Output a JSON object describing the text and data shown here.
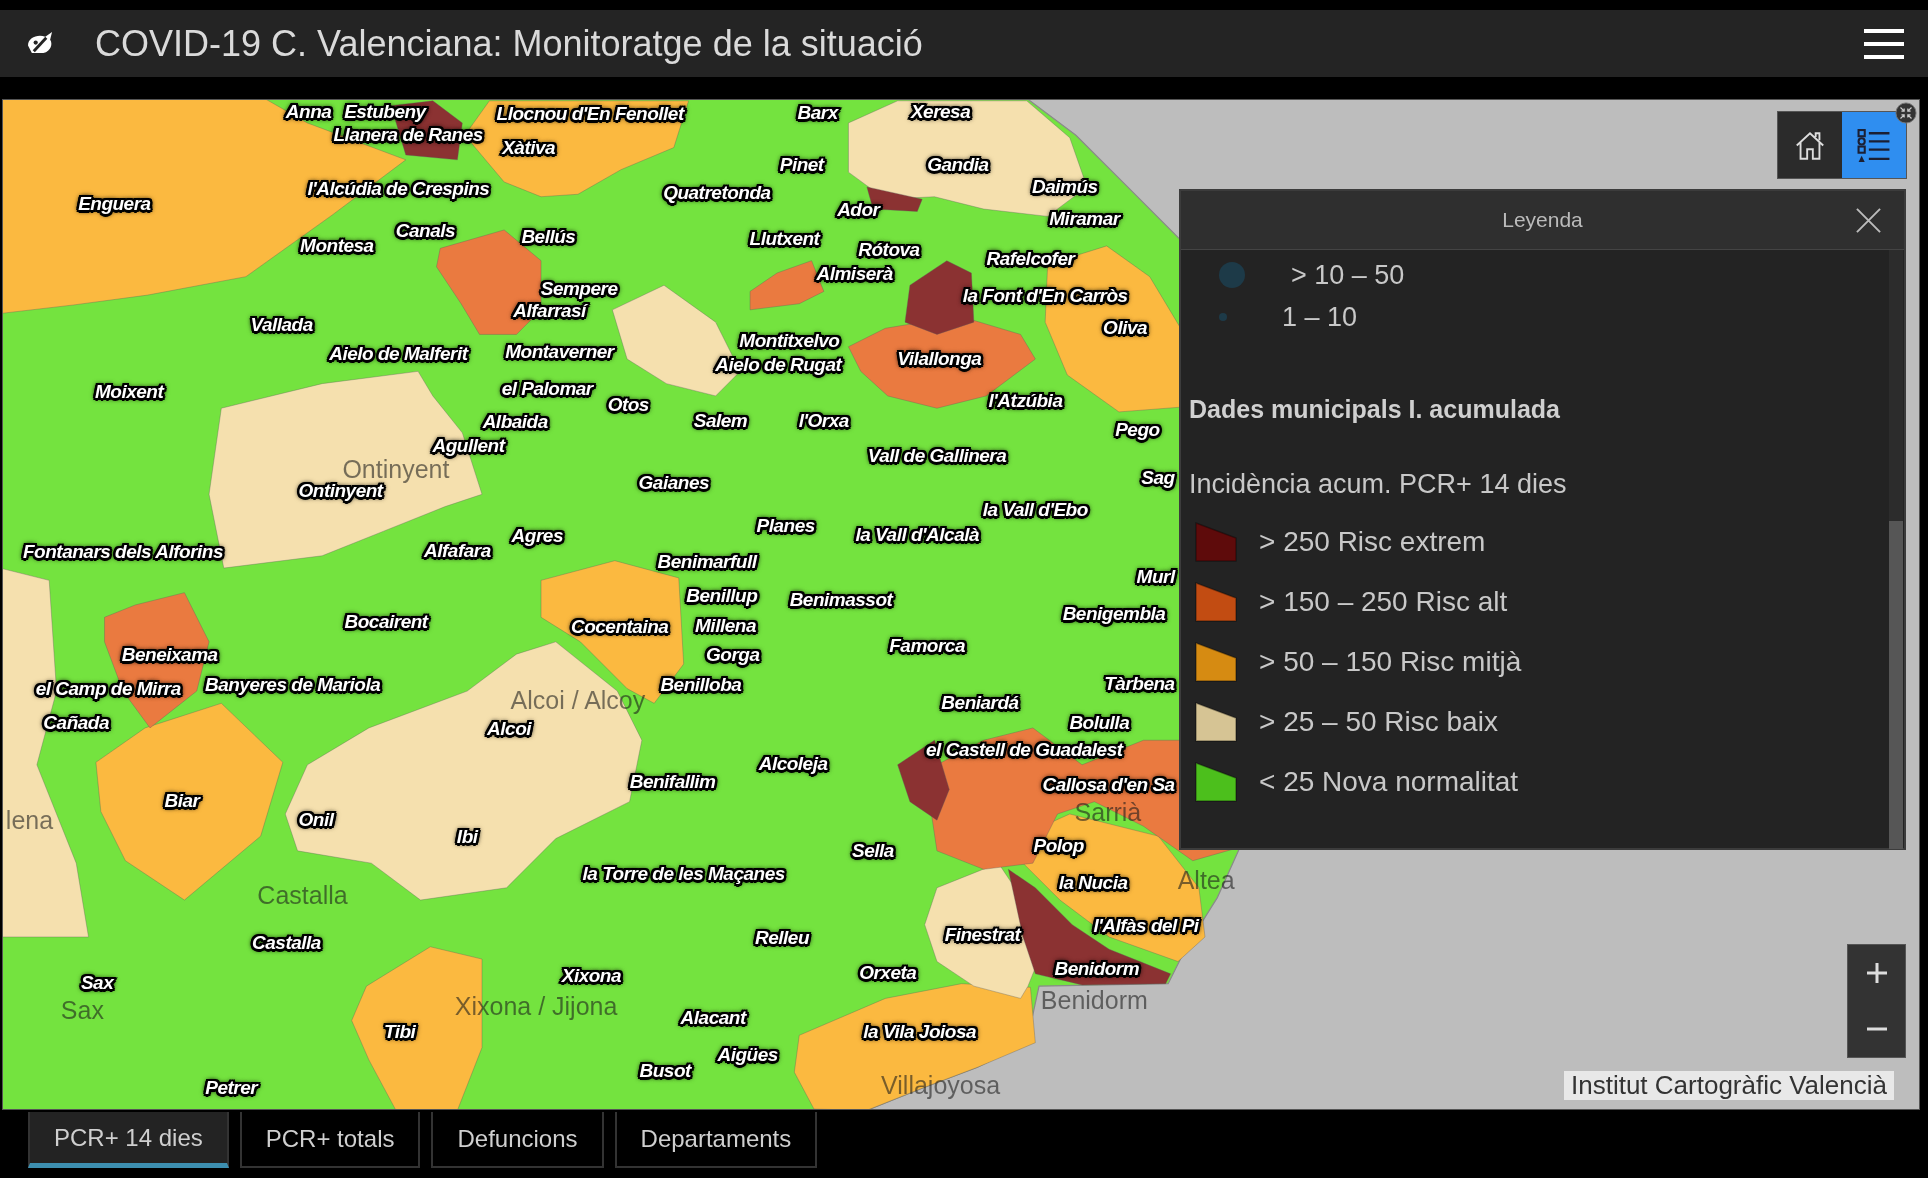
{
  "header": {
    "title": "COVID-19 C. Valenciana: Monitoratge de la situació"
  },
  "map": {
    "labels": [
      "Anna",
      "Estubeny",
      "Llocnou d'En Fenollet",
      "Barx",
      "Xeresa",
      "Llanera de Ranes",
      "Xàtiva",
      "Pinet",
      "Gandia",
      "l'Alcúdia de Crespins",
      "Quatretonda",
      "Daimús",
      "Enguera",
      "Ador",
      "Miramar",
      "Canals",
      "Montesa",
      "Bellús",
      "Llutxent",
      "Rótova",
      "Rafelcofer",
      "Almiserà",
      "Sempere",
      "la Font d'En Carròs",
      "Alfarrasí",
      "Vallada",
      "Oliva",
      "Montitxelvo",
      "Aielo de Malferit",
      "Montaverner",
      "Aielo de Rugat",
      "Vilallonga",
      "Moixent",
      "el Palomar",
      "Otos",
      "l'Atzúbia",
      "Albaida",
      "Salem",
      "l'Orxa",
      "Pego",
      "Agullent",
      "Vall de Gallinera",
      "Ontinyent",
      "Gaianes",
      "Sag",
      "la Vall d'Ebo",
      "Planes",
      "Agres",
      "la Vall d'Alcalà",
      "Fontanars dels Alforins",
      "Alfafara",
      "Benimarfull",
      "Murl",
      "Benillup",
      "Benimassot",
      "Bocairent",
      "Cocentaina",
      "Millena",
      "Benigembla",
      "Famorca",
      "Beneixama",
      "Gorga",
      "el Camp de Mirra",
      "Banyeres de Mariola",
      "Benilloba",
      "Tàrbena",
      "Beniardá",
      "Cañada",
      "Alcoi",
      "Bolulla",
      "el Castell de Guadalest",
      "Alcoleja",
      "Benifallim",
      "Callosa d'en Sa",
      "Biar",
      "Onil",
      "Ibi",
      "Sella",
      "Polop",
      "la Torre de les Maçanes",
      "la Nucia",
      "Castalla",
      "Relleu",
      "Finestrat",
      "l'Alfàs del Pi",
      "Sax",
      "Xixona",
      "Orxeta",
      "Benidorm",
      "Tibi",
      "Alacant",
      "la Vila Joiosa",
      "Aigües",
      "Busot",
      "Petrer"
    ],
    "basemap_labels": [
      "Ontinyent",
      "Alcoi / Alcoy",
      "lena",
      "Sarrià",
      "Castalla",
      "Altea",
      "Sax",
      "Xixona / Jijona",
      "Benidorm",
      "Villajoyosa"
    ],
    "attribution": "Institut Cartogràfic Valencià"
  },
  "map_widgets": [
    {
      "kind": "home",
      "selected": false
    },
    {
      "kind": "legend",
      "selected": true
    }
  ],
  "legend": {
    "title": "Leyenda",
    "symbols": [
      {
        "kind": "large",
        "label": "> 10 – 50"
      },
      {
        "kind": "small",
        "label": "1 – 10"
      }
    ],
    "layer_title": "Dades municipals I. acumulada",
    "field_title": "Incidència acum. PCR+ 14 dies",
    "classes": [
      {
        "label": "> 250 Risc extrem",
        "color": "#5e0b0b"
      },
      {
        "label": "> 150 – 250 Risc alt",
        "color": "#c24c12"
      },
      {
        "label": "> 50 – 150 Risc mitjà",
        "color": "#d68b12"
      },
      {
        "label": "> 25 – 50 Risc baix",
        "color": "#d6c494"
      },
      {
        "label": "< 25 Nova normalitat",
        "color": "#4cbf1c"
      }
    ]
  },
  "tabs": [
    {
      "label": "PCR+ 14 dies",
      "selected": true
    },
    {
      "label": "PCR+ totals",
      "selected": false
    },
    {
      "label": "Defuncions",
      "selected": false
    },
    {
      "label": "Departaments",
      "selected": false
    }
  ]
}
